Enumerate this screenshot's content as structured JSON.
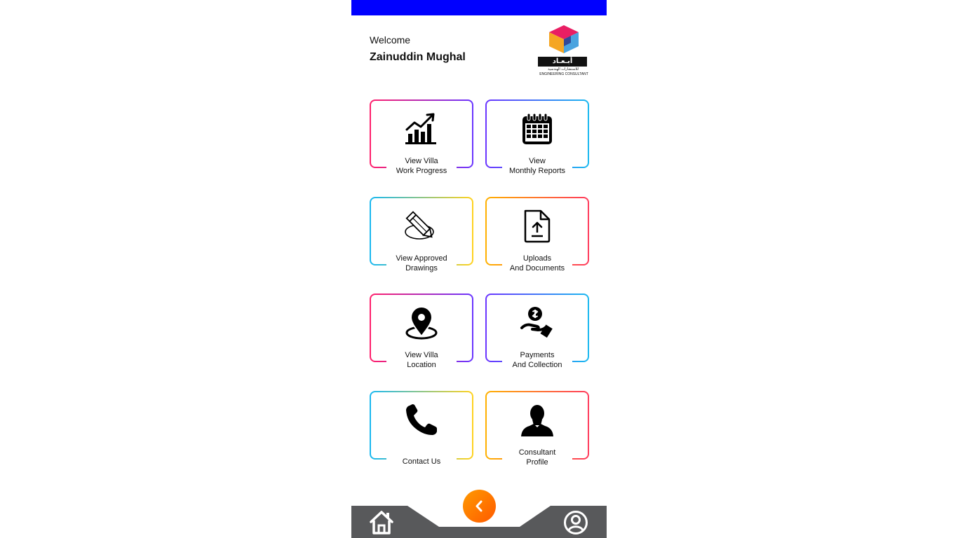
{
  "header": {
    "welcome_label": "Welcome",
    "user_name": "Zainuddin Mughal"
  },
  "logo": {
    "arabic_title": "أبـعـاد",
    "arabic_subtitle": "للاستشارات الهندسية",
    "caption": "ENGINEERING CONSULTANT",
    "colors": [
      "#e91e63",
      "#f5a623",
      "#4aa3df",
      "#2e3a8c"
    ]
  },
  "tiles": [
    {
      "id": "work-progress",
      "lines": [
        "View Villa",
        "Work Progress"
      ],
      "icon": "chart-growth-icon",
      "gradient": [
        "#ff1f6b",
        "#6a35ff"
      ]
    },
    {
      "id": "monthly-reports",
      "lines": [
        "View",
        "Monthly Reports"
      ],
      "icon": "calendar-icon",
      "gradient": [
        "#6a35ff",
        "#1ab8f0"
      ]
    },
    {
      "id": "approved-drawings",
      "lines": [
        "View Approved",
        "Drawings"
      ],
      "icon": "pencil-drawing-icon",
      "gradient": [
        "#19b8f0",
        "#ffd21f"
      ]
    },
    {
      "id": "uploads-documents",
      "lines": [
        "Uploads",
        "And Documents"
      ],
      "icon": "file-upload-icon",
      "gradient": [
        "#ffb000",
        "#ff3b5c"
      ]
    },
    {
      "id": "villa-location",
      "lines": [
        "View Villa",
        "Location"
      ],
      "icon": "location-pin-icon",
      "gradient": [
        "#ff1f6b",
        "#6a35ff"
      ]
    },
    {
      "id": "payments-collection",
      "lines": [
        "Payments",
        "And Collection"
      ],
      "icon": "payment-hand-icon",
      "gradient": [
        "#6a35ff",
        "#1ab8f0"
      ]
    },
    {
      "id": "contact-us",
      "lines": [
        "Contact Us"
      ],
      "icon": "phone-icon",
      "gradient": [
        "#19b8f0",
        "#ffd21f"
      ]
    },
    {
      "id": "consultant-profile",
      "lines": [
        "Consultant",
        "Profile"
      ],
      "icon": "person-silhouette-icon",
      "gradient": [
        "#ffb000",
        "#ff3b5c"
      ]
    }
  ],
  "nav": {
    "home_icon": "home-icon",
    "back_icon": "chevron-left-icon",
    "profile_icon": "user-circle-icon",
    "bar_color": "#58595b",
    "status_bar_color": "#0000ff"
  }
}
